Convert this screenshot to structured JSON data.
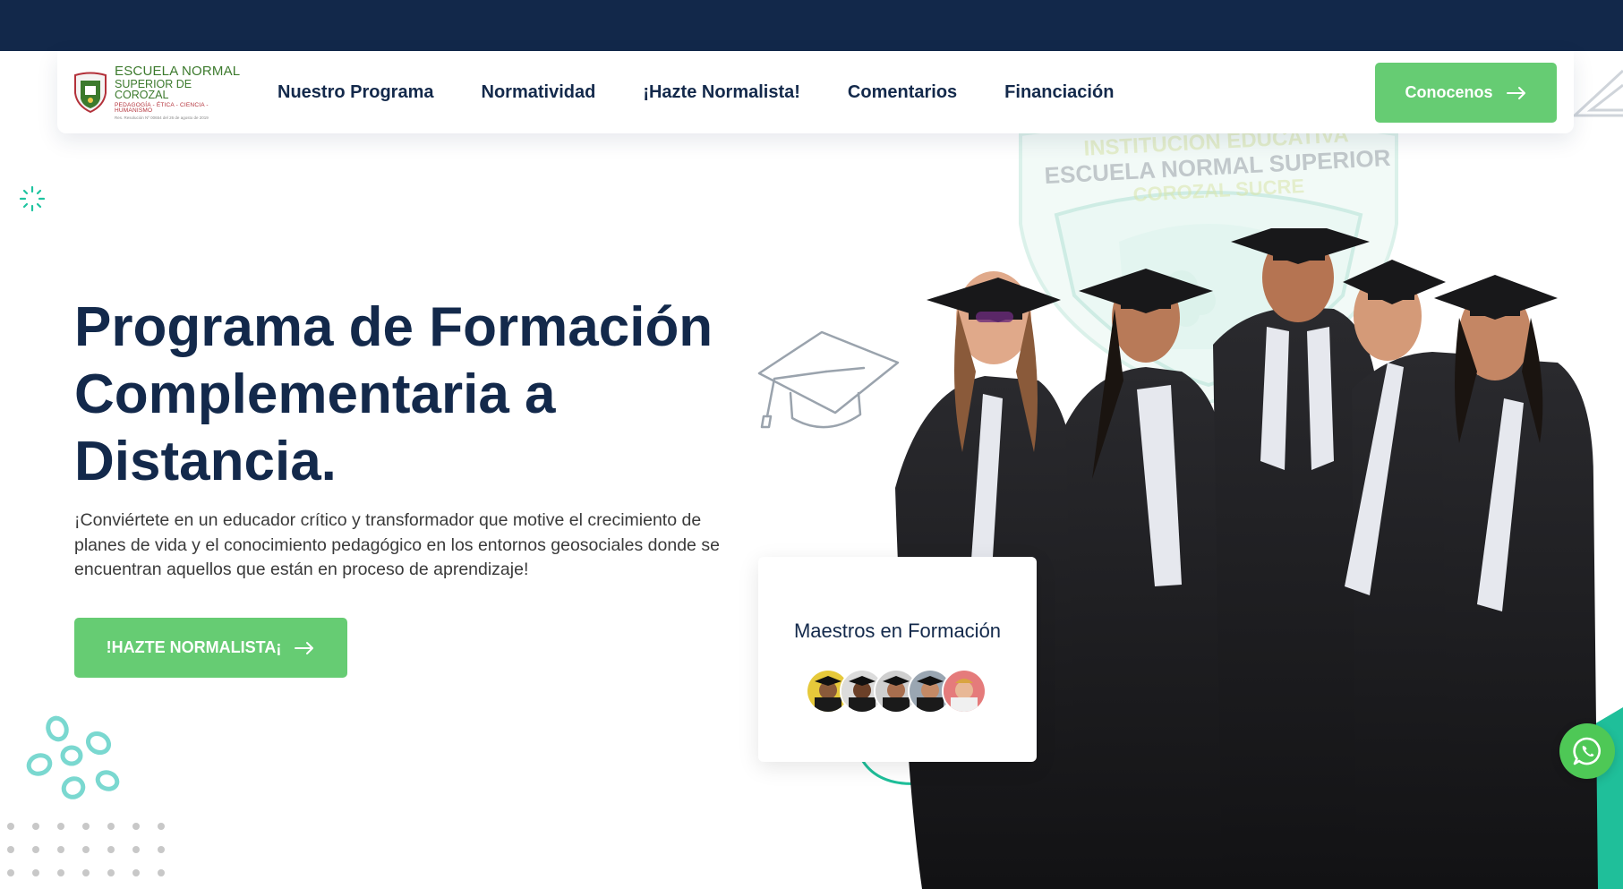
{
  "logo": {
    "line1": "ESCUELA NORMAL",
    "line2": "SUPERIOR DE COROZAL",
    "line3": "PEDAGOGÍA - ÉTICA - CIENCIA - HUMANISMO",
    "line4": "Res. Resolución Nº 00654 del 26 de agosto de 2019"
  },
  "nav": {
    "items": [
      {
        "label": "Nuestro Programa"
      },
      {
        "label": "Normatividad"
      },
      {
        "label": "¡Hazte Normalista!"
      },
      {
        "label": "Comentarios"
      },
      {
        "label": "Financiación"
      }
    ],
    "cta_label": "Conocenos"
  },
  "hero": {
    "title_line1": "Programa de Formación",
    "title_line2": "Complementaria a",
    "title_line3": "Distancia.",
    "text_line1": "¡Conviértete en un educador crítico y transformador que motive el crecimiento de",
    "text_line2": "planes de vida y el conocimiento pedagógico en los entornos geosociales donde se",
    "text_line3": "encuentran aquellos que están en proceso de aprendizaje!",
    "cta_label": "!HAZTE NORMALISTA¡"
  },
  "badge": {
    "title": "Maestros en Formación"
  },
  "watermark": {
    "line1": "INSTITUCION EDUCATIVA",
    "line2": "ESCUELA NORMAL SUPERIOR",
    "line3": "COROZAL SUCRE"
  },
  "colors": {
    "navy": "#12284a",
    "accent_green": "#66cc73",
    "teal": "#1fc4a0",
    "whatsapp": "#4ec856"
  },
  "icons": {
    "arrow": "arrow-right-icon",
    "whatsapp": "whatsapp-icon",
    "cap": "graduation-cap-icon"
  }
}
